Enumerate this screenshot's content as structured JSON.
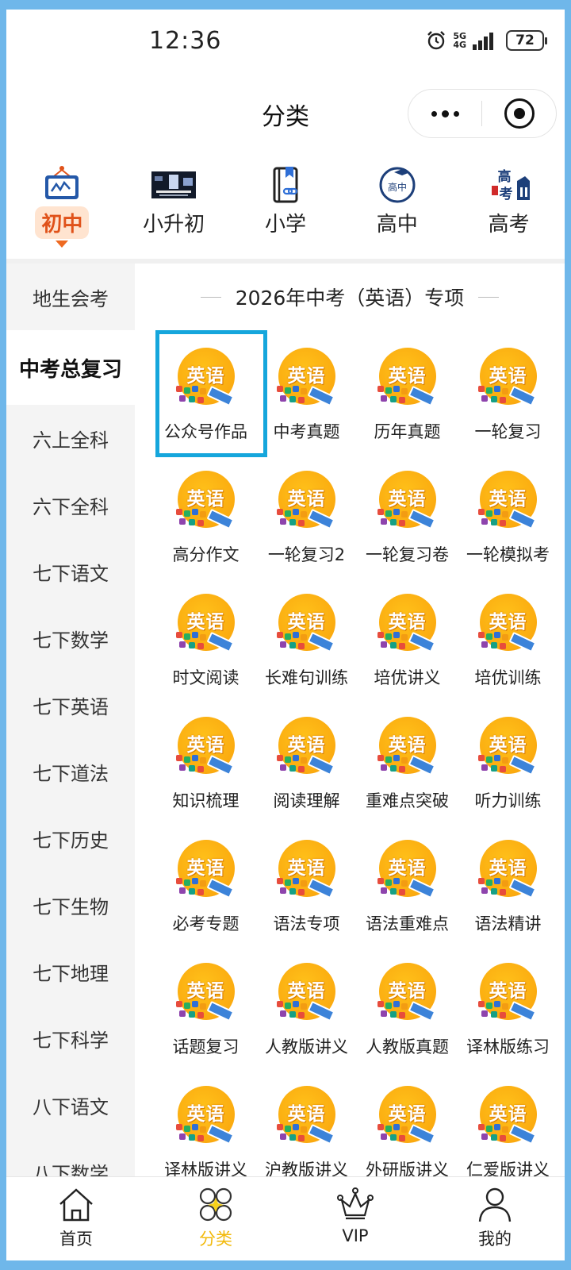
{
  "status_bar": {
    "time": "12:36",
    "network": "5G",
    "signal": "4G",
    "battery": "72"
  },
  "header": {
    "title": "分类"
  },
  "level_tabs": [
    {
      "label": "初中",
      "icon": "board-icon",
      "active": true
    },
    {
      "label": "小升初",
      "icon": "xiaoshengchu-banner-icon",
      "active": false
    },
    {
      "label": "小学",
      "icon": "book-link-icon",
      "active": false
    },
    {
      "label": "高中",
      "icon": "gaozhong-badge-icon",
      "active": false
    },
    {
      "label": "高考",
      "icon": "gaokao-icon",
      "active": false
    }
  ],
  "sidebar": {
    "items": [
      {
        "label": "地生会考",
        "active": false
      },
      {
        "label": "中考总复习",
        "active": true
      },
      {
        "label": "六上全科",
        "active": false
      },
      {
        "label": "六下全科",
        "active": false
      },
      {
        "label": "七下语文",
        "active": false
      },
      {
        "label": "七下数学",
        "active": false
      },
      {
        "label": "七下英语",
        "active": false
      },
      {
        "label": "七下道法",
        "active": false
      },
      {
        "label": "七下历史",
        "active": false
      },
      {
        "label": "七下生物",
        "active": false
      },
      {
        "label": "七下地理",
        "active": false
      },
      {
        "label": "七下科学",
        "active": false
      },
      {
        "label": "八下语文",
        "active": false
      },
      {
        "label": "八下数学",
        "active": false
      }
    ]
  },
  "section": {
    "title": "2026年中考（英语）专项"
  },
  "icon_text": "英语",
  "grid_items": [
    "公众号作品",
    "中考真题",
    "历年真题",
    "一轮复习",
    "高分作文",
    "一轮复习2",
    "一轮复习卷",
    "一轮模拟考",
    "时文阅读",
    "长难句训练",
    "培优讲义",
    "培优训练",
    "知识梳理",
    "阅读理解",
    "重难点突破",
    "听力训练",
    "必考专题",
    "语法专项",
    "语法重难点",
    "语法精讲",
    "话题复习",
    "人教版讲义",
    "人教版真题",
    "译林版练习",
    "译林版讲义",
    "沪教版讲义",
    "外研版讲义",
    "仁爱版讲义"
  ],
  "bottom_nav": [
    {
      "label": "首页",
      "icon": "home-icon",
      "active": false
    },
    {
      "label": "分类",
      "icon": "category-icon",
      "active": true
    },
    {
      "label": "VIP",
      "icon": "crown-icon",
      "active": false
    },
    {
      "label": "我的",
      "icon": "profile-icon",
      "active": false
    }
  ],
  "colors": {
    "accent": "#ee6a22",
    "active_nav": "#f2b90a",
    "highlight_border": "#15a6dc",
    "icon_orange": "#fbab10",
    "frame": "#6fb7ea"
  }
}
